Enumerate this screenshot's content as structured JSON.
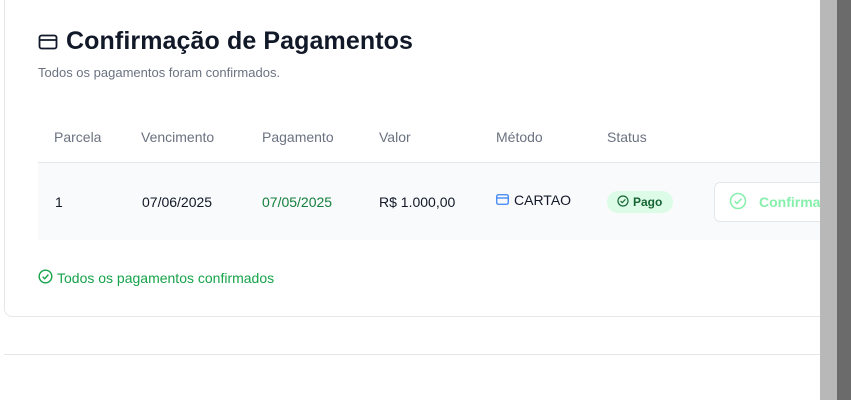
{
  "header": {
    "title": "Confirmação de Pagamentos",
    "subtitle": "Todos os pagamentos foram confirmados.",
    "icon": "card-icon"
  },
  "table": {
    "columns": [
      "Parcela",
      "Vencimento",
      "Pagamento",
      "Valor",
      "Método",
      "Status"
    ],
    "rows": [
      {
        "parcela": "1",
        "vencimento": "07/06/2025",
        "pagamento": "07/05/2025",
        "valor": "R$ 1.000,00",
        "metodo": "CARTAO",
        "status": "Pago",
        "action_label": "Confirmar"
      }
    ]
  },
  "footer": {
    "note": "Todos os pagamentos confirmados"
  },
  "colors": {
    "accent_green": "#16a34a",
    "badge_bg": "#dcfce7",
    "badge_text": "#166534",
    "method_icon": "#3b82f6"
  }
}
